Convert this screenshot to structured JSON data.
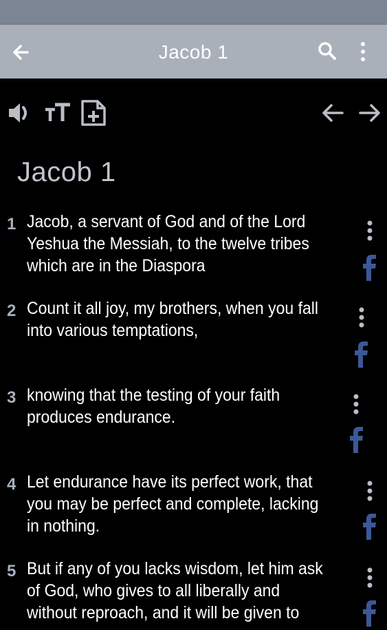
{
  "app": {
    "title": "Jacob 1"
  },
  "icons": {
    "back": "arrow-left-icon",
    "search": "search-icon",
    "more": "more-vert-icon",
    "speaker": "speaker-icon",
    "text_size": "text-size-icon",
    "bookmark": "add-note-icon",
    "prev": "prev-chapter-icon",
    "next": "next-chapter-icon",
    "facebook": "facebook-icon"
  },
  "colors": {
    "appbar": "#a9b0ba",
    "statusbar": "#7b8594",
    "background": "#000000",
    "verse_number": "#a8b0bc",
    "facebook": "#3b5998"
  },
  "chapter": {
    "heading": "Jacob 1",
    "verses": [
      {
        "num": "1",
        "text": "Jacob, a servant of God and of the Lord Yeshua the Messiah, to the twelve tribes which are in the Diaspora"
      },
      {
        "num": "2",
        "text": "Count it all joy, my brothers, when you fall into various temptations,"
      },
      {
        "num": "3",
        "text": "knowing that the testing of your faith produces endurance."
      },
      {
        "num": "4",
        "text": "Let endurance have its perfect work, that you may be perfect and complete, lacking in nothing."
      },
      {
        "num": "5",
        "text": "But if any of you lacks wisdom, let him ask of God, who gives to all liberally and without reproach, and it will be given to"
      }
    ]
  }
}
